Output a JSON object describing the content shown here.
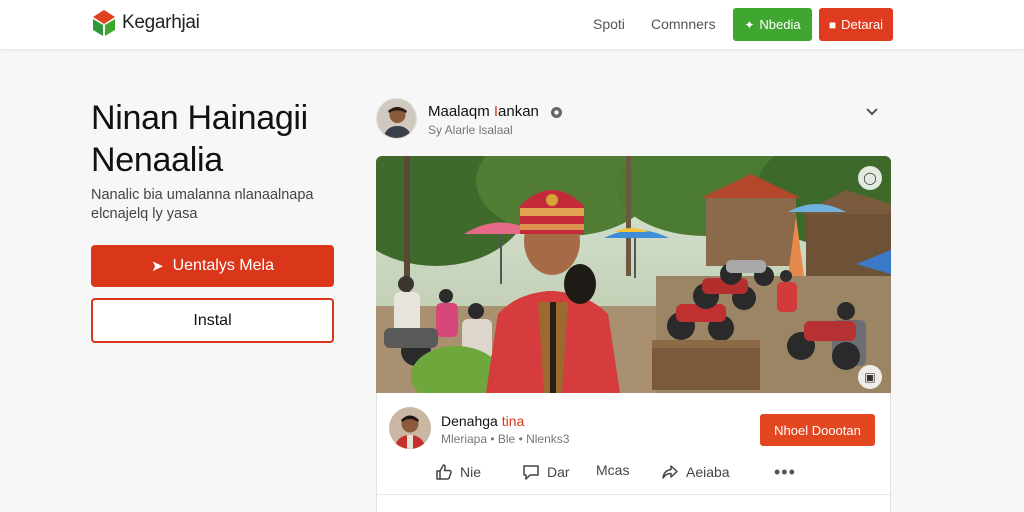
{
  "header": {
    "logo_text": "Kegarhjai",
    "nav": [
      "Spoti",
      "Comnners"
    ],
    "green_button": "Nbedia",
    "red_button": "Detarai"
  },
  "hero": {
    "title_line1": "Ninan Hainagii",
    "title_line2": "Nenaalia",
    "subtitle": "Nanalic bia umalanna nlanaalnapa elcnajelq ly yasa",
    "primary_button": "Uentalys Mela",
    "secondary_button": "Instal"
  },
  "post": {
    "author_pre": "Maalaqm ",
    "author_accent": "I",
    "author_post": "ankan",
    "meta": "Sy Alarle lsalaal"
  },
  "card": {
    "name_pre": "Denahga ",
    "name_accent": "tina",
    "meta": "Mleriapa • Ble • Nlenks3",
    "button": "Nhoel Doootan",
    "actions": {
      "like": "Nie",
      "comment": "Dar",
      "meas": "Mcas",
      "share": "Aeiaba"
    }
  },
  "colors": {
    "brand_red": "#d9361a",
    "brand_green": "#3fa62f"
  },
  "icons": [
    "logo-icon",
    "globe-icon",
    "chevron-down-icon",
    "thumbs-up-icon",
    "comment-icon",
    "share-icon",
    "more-icon"
  ]
}
